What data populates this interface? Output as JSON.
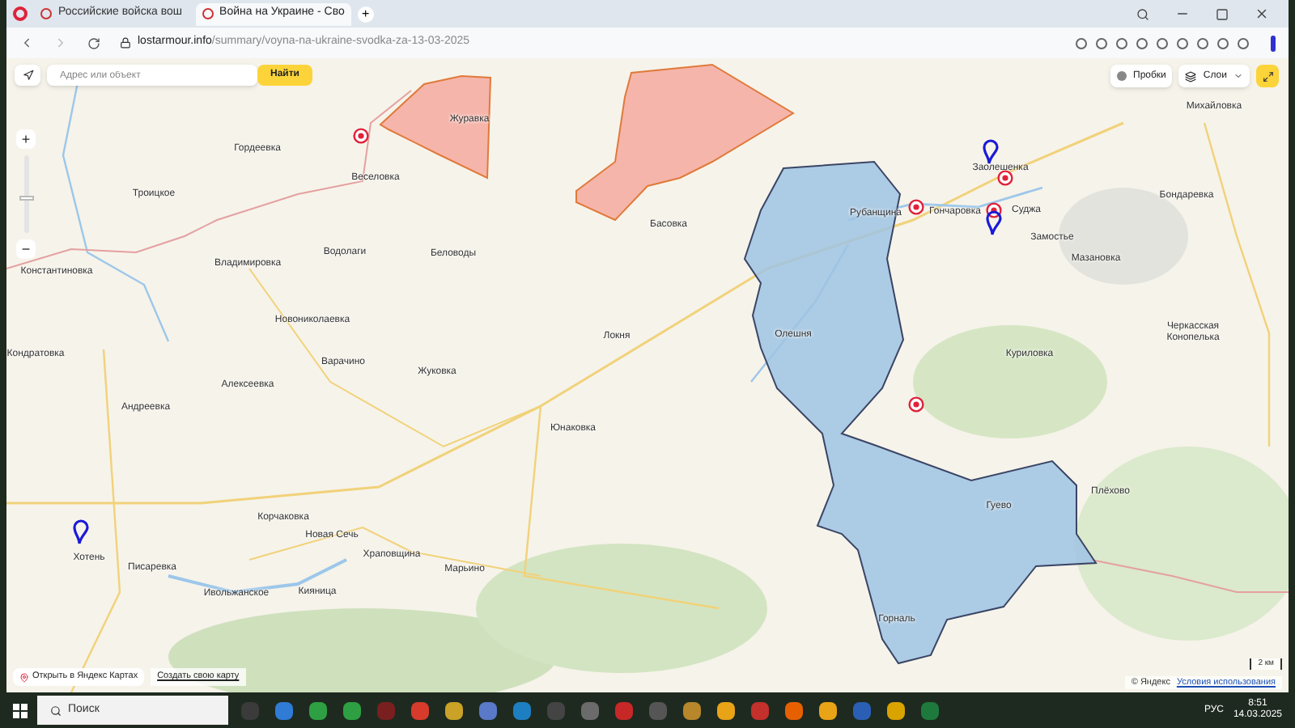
{
  "browser": {
    "tabs": [
      {
        "title": "Российские войска вош",
        "selected": false
      },
      {
        "title": "Война на Украине - Сво",
        "selected": true
      }
    ],
    "new_tab": "+",
    "address": {
      "host": "lostarmour.info",
      "path": "/summary/voyna-na-ukraine-svodka-za-13-03-2025"
    }
  },
  "map": {
    "search": {
      "placeholder": "Адрес или объект",
      "button": "Найти"
    },
    "traffic": "Пробки",
    "layers": "Слои",
    "zoom_in": "+",
    "zoom_out": "−",
    "zoom": {
      "level": 0.45
    },
    "places": [
      "Журавка",
      "Гордеевка",
      "Веселовка",
      "Троицкое",
      "Водолаги",
      "Беловоды",
      "Владимировка",
      "Константиновка",
      "Новониколаевка",
      "Локня",
      "Кондратовка",
      "Варачино",
      "Жуковка",
      "Алексеевка",
      "Андреевка",
      "Басовка",
      "Заолешенка",
      "Рубанщина",
      "Гончаровка",
      "Суджа",
      "Замостье",
      "Мазановка",
      "Михайловка",
      "Бондаревка",
      "Черкасская Конопелька",
      "Куриловка",
      "Олешня",
      "Юнаковка",
      "Плёхово",
      "Гуево",
      "Корчаковка",
      "Новая Сечь",
      "Хотень",
      "Писаревка",
      "Храповщина",
      "Марьино",
      "Ивольжанское",
      "Кияница",
      "Горналь"
    ],
    "open_link": "Открыть в Яндекс Картах",
    "create_link": "Создать свою карту",
    "copyright": "© Яндекс",
    "terms": "Условия использования",
    "scale": "2 км"
  },
  "taskbar": {
    "search_placeholder": "Поиск",
    "language": "РУС",
    "time": "8:51",
    "date": "14.03.2025"
  }
}
